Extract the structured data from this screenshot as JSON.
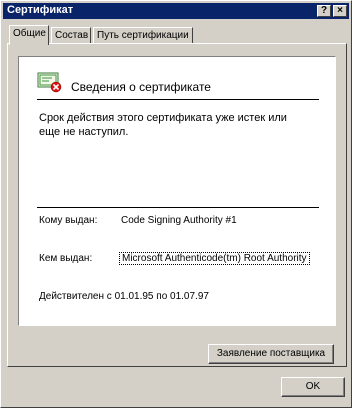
{
  "window": {
    "title": "Сертификат",
    "help_label": "?",
    "close_label": "×"
  },
  "tabs": [
    {
      "label": "Общие"
    },
    {
      "label": "Состав"
    },
    {
      "label": "Путь сертификации"
    }
  ],
  "general": {
    "heading": "Сведения о сертификате",
    "warning": "Срок действия этого сертификата уже истек или еще не наступил.",
    "issued_to_label": "Кому выдан:",
    "issued_to_value": "Code Signing Authority #1",
    "issued_by_label": "Кем выдан:",
    "issued_by_value": "Microsoft Authenticode(tm) Root Authority",
    "validity_text": "Действителен с 01.01.95 по 01.07.97"
  },
  "buttons": {
    "issuer_statement": "Заявление поставщика",
    "ok": "OK"
  }
}
